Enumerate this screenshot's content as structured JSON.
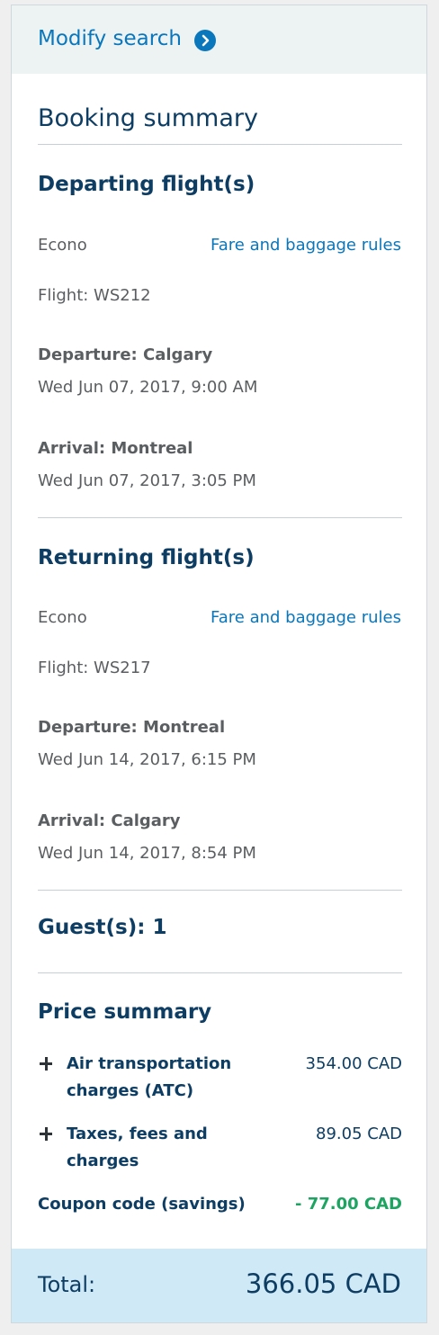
{
  "modify_search": {
    "label": "Modify search",
    "icon": "chevron-right-circle-icon",
    "accent_color": "#0a76bb"
  },
  "booking_summary": {
    "title": "Booking summary"
  },
  "departing": {
    "title": "Departing flight(s)",
    "fare_class": "Econo",
    "fare_rules_link": "Fare and baggage rules",
    "flight": "Flight: WS212",
    "departure_label": "Departure: Calgary",
    "departure_time": "Wed Jun 07, 2017, 9:00 AM",
    "arrival_label": "Arrival: Montreal",
    "arrival_time": "Wed Jun 07, 2017, 3:05 PM"
  },
  "returning": {
    "title": "Returning flight(s)",
    "fare_class": "Econo",
    "fare_rules_link": "Fare and baggage rules",
    "flight": "Flight: WS217",
    "departure_label": "Departure: Montreal",
    "departure_time": "Wed Jun 14, 2017, 6:15 PM",
    "arrival_label": "Arrival: Calgary",
    "arrival_time": "Wed Jun 14, 2017, 8:54 PM"
  },
  "guests": {
    "label": "Guest(s): 1"
  },
  "price_summary": {
    "title": "Price summary",
    "items": [
      {
        "label": "Air transportation charges (ATC)",
        "value": "354.00 CAD",
        "icon": "plus-icon"
      },
      {
        "label": "Taxes, fees and charges",
        "value": "89.05 CAD",
        "icon": "plus-icon"
      }
    ],
    "coupon": {
      "label": "Coupon code (savings)",
      "value": "- 77.00 CAD",
      "color": "#1ea462"
    }
  },
  "total": {
    "label": "Total:",
    "value": "366.05 CAD"
  },
  "colors": {
    "heading": "#0e3d63",
    "link": "#0a76bb",
    "total_background": "#cfe9f6",
    "modify_background": "#edf3f3"
  }
}
